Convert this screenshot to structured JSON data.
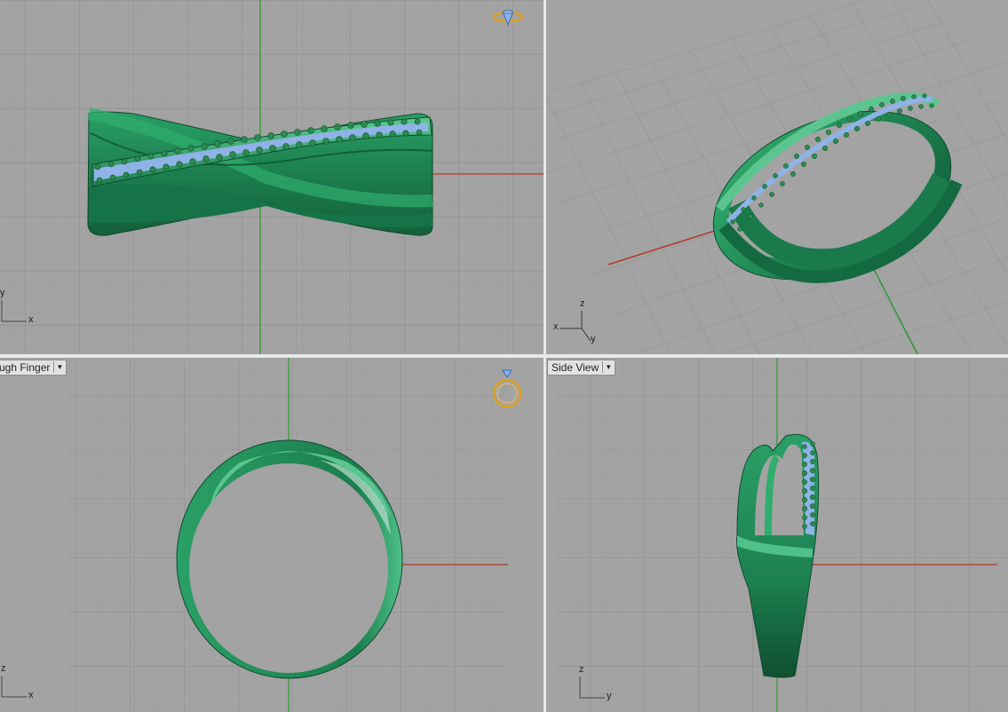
{
  "app": "Rhino viewports",
  "viewports": {
    "top": {
      "axis_x": "x",
      "axis_y": "y"
    },
    "perspective": {
      "axis_x": "x",
      "axis_y": "y",
      "axis_z": "z"
    },
    "front": {
      "label": "ugh Finger",
      "axis_x": "x",
      "axis_z": "z"
    },
    "right": {
      "label": "Side View",
      "axis_y": "y",
      "axis_z": "z"
    }
  },
  "icons": {
    "ring_top": "ring-diamond-icon",
    "ring_front": "ring-front-icon",
    "dropdown": "chevron-down-icon"
  },
  "colors": {
    "viewport_bg": "#a3a3a3",
    "grid_minor": "#999999",
    "grid_major": "#8a8a8a",
    "axis_x": "#b33a2a",
    "axis_y": "#2e9a2e",
    "ring": "#1f8a56",
    "ring_highlight": "#4fc08a",
    "stones": "#8fb3e6",
    "gizmo": "#e0a020"
  }
}
